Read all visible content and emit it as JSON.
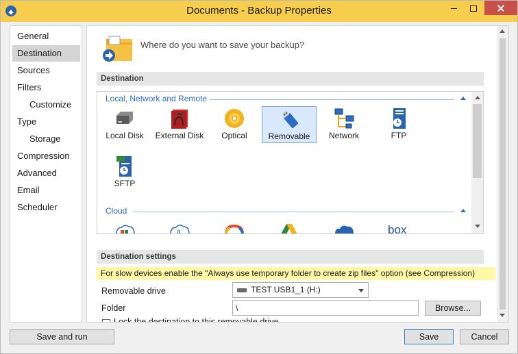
{
  "window": {
    "title": "Documents - Backup Properties",
    "accent_color": "#f6cd4c",
    "controls": [
      "minimize-icon",
      "maximize-icon",
      "close-icon"
    ]
  },
  "nav": {
    "items": [
      {
        "label": "General",
        "active": false
      },
      {
        "label": "Destination",
        "active": true
      },
      {
        "label": "Sources",
        "active": false
      },
      {
        "label": "Filters",
        "active": false
      },
      {
        "label": "Customize",
        "active": false,
        "sub": true
      },
      {
        "label": "Type",
        "active": false
      },
      {
        "label": "Storage",
        "active": false,
        "sub": true
      },
      {
        "label": "Compression",
        "active": false
      },
      {
        "label": "Advanced",
        "active": false
      },
      {
        "label": "Email",
        "active": false
      },
      {
        "label": "Scheduler",
        "active": false
      }
    ]
  },
  "header": {
    "question": "Where do you want to save your backup?"
  },
  "destination": {
    "section_title": "Destination",
    "group_local": "Local, Network and Remote",
    "group_cloud": "Cloud",
    "items": [
      {
        "label": "Local Disk",
        "icon": "hard-disk-icon"
      },
      {
        "label": "External Disk",
        "icon": "external-disk-icon"
      },
      {
        "label": "Optical",
        "icon": "optical-disc-icon"
      },
      {
        "label": "Removable",
        "icon": "usb-drive-icon",
        "selected": true
      },
      {
        "label": "Network",
        "icon": "network-icon"
      },
      {
        "label": "FTP",
        "icon": "ftp-icon"
      },
      {
        "label": "SFTP",
        "icon": "sftp-icon"
      }
    ],
    "cloud_icons": [
      "onedrive-business-icon",
      "amazon-s3-icon",
      "google-cloud-icon",
      "google-drive-icon",
      "onedrive-icon",
      "box-icon"
    ],
    "cloud_box_text": "box"
  },
  "settings": {
    "section_title": "Destination settings",
    "note": "For slow devices enable the \"Always use temporary folder to create zip files\" option (see Compression)",
    "removable_label": "Removable drive",
    "removable_value": "TEST USB1_1 (H:)",
    "folder_label": "Folder",
    "folder_value": "\\",
    "browse_label": "Browse...",
    "lock_label": "Lock the destination to this removable drive"
  },
  "footer": {
    "save_run": "Save and run",
    "save": "Save",
    "cancel": "Cancel"
  }
}
